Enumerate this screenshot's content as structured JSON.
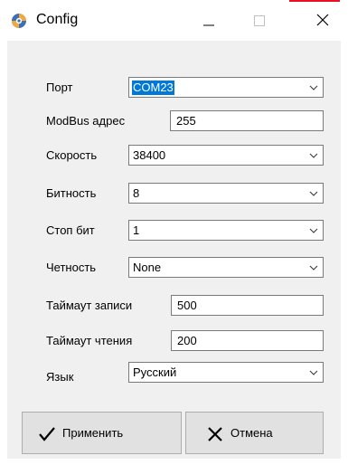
{
  "window": {
    "title": "Config",
    "icon": "gear-icon",
    "controls": [
      "minimize-icon",
      "maximize-icon",
      "close-icon"
    ],
    "accent_color": "#0078d7",
    "close_hover_color": "#e81123"
  },
  "form": {
    "port": {
      "label": "Порт",
      "value": "COM23",
      "focused": true
    },
    "modbus_address": {
      "label": "ModBus адрес",
      "value": "255"
    },
    "speed": {
      "label": "Скорость",
      "value": "38400"
    },
    "bits": {
      "label": "Битность",
      "value": "8"
    },
    "stop_bits": {
      "label": "Стоп бит",
      "value": "1"
    },
    "parity": {
      "label": "Четность",
      "value": "None"
    },
    "write_timeout": {
      "label": "Таймаут записи",
      "value": "500"
    },
    "read_timeout": {
      "label": "Таймаут чтения",
      "value": "200"
    },
    "language": {
      "label": "Язык",
      "value": "Русский"
    }
  },
  "buttons": {
    "apply": {
      "label": "Применить",
      "icon": "checkmark-icon"
    },
    "cancel": {
      "label": "Отмена",
      "icon": "x-icon"
    }
  }
}
